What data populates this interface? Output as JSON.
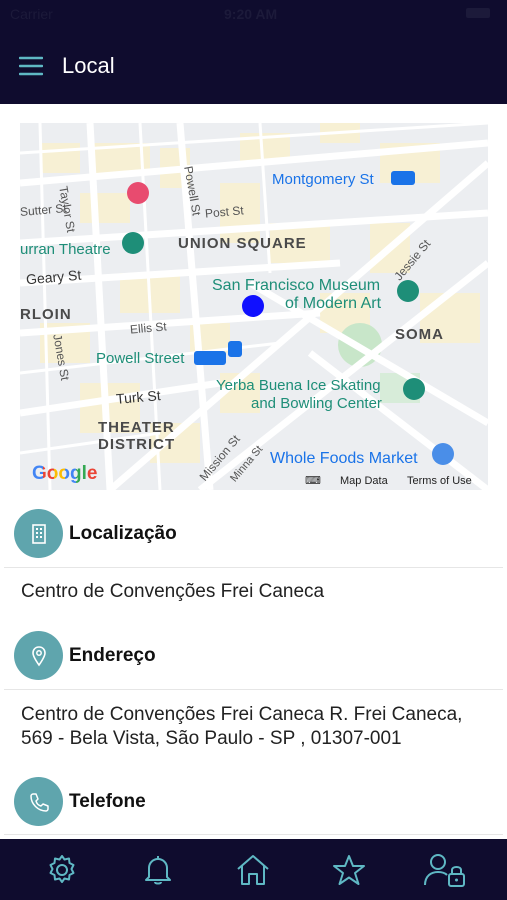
{
  "status_bar": {
    "carrier": "Carrier",
    "time": "9:20 AM"
  },
  "header": {
    "title": "Local",
    "menu_icon": "hamburger-menu-icon"
  },
  "map": {
    "labels": {
      "montgomery": "Montgomery St",
      "taylor": "Taylor St",
      "powell": "Powell St",
      "post": "Post St",
      "sutter": "Sutter St",
      "curran": "urran Theatre",
      "union_square": "UNION SQUARE",
      "geary": "Geary St",
      "jessie": "Jessie St",
      "sfmoma_1": "San Francisco Museum",
      "sfmoma_2": "of Modern Art",
      "tenderloin": "RLOIN",
      "ellis": "Ellis St",
      "soma": "SOMA",
      "jones": "Jones St",
      "powell_station": "Powell Street",
      "turk": "Turk St",
      "yerba_1": "Yerba Buena Ice Skating",
      "yerba_2": "and Bowling Center",
      "theater_1": "THEATER",
      "theater_2": "DISTRICT",
      "mission": "Mission St",
      "minna": "Minna St",
      "whole_foods": "Whole Foods Market",
      "google": "Google",
      "map_data": "Map Data",
      "terms": "Terms of Use"
    }
  },
  "sections": {
    "location": {
      "title": "Localização",
      "value": "Centro de Convenções Frei Caneca"
    },
    "address": {
      "title": "Endereço",
      "value_line1": "Centro de Convenções Frei Caneca R. Frei Caneca,",
      "value_line2": "569 - Bela Vista, São Paulo - SP , 01307-001"
    },
    "phone": {
      "title": "Telefone"
    }
  },
  "tab_bar": {
    "items": [
      "settings-icon",
      "bell-icon",
      "home-icon",
      "star-icon",
      "user-lock-icon"
    ]
  },
  "colors": {
    "header_bg": "#0f0c2e",
    "accent_teal": "#5fa5ad",
    "icon_tint": "#5fb8c4",
    "map_dot": "#1010ff"
  }
}
